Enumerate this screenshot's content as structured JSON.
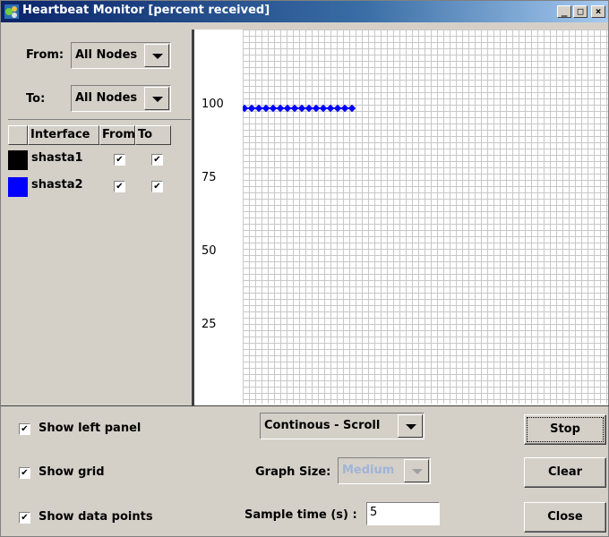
{
  "window": {
    "title": "Heartbeat Monitor [percent received]",
    "controls": {
      "minimize": "_",
      "maximize": "□",
      "close": "×"
    }
  },
  "left_panel": {
    "from_label": "From:",
    "from_value": "All Nodes",
    "to_label": "To:",
    "to_value": "All Nodes",
    "table": {
      "headers": [
        "Interface",
        "From",
        "To"
      ],
      "rows": [
        {
          "color": "#000000",
          "name": "shasta1",
          "from": true,
          "to": true
        },
        {
          "color": "#0000ff",
          "name": "shasta2",
          "from": true,
          "to": true
        }
      ]
    }
  },
  "graph": {
    "y_ticks": [
      "100",
      "75",
      "50",
      "25"
    ],
    "series_color": "#0000ff",
    "points": 16,
    "value": 100
  },
  "options": {
    "show_left_panel": "Show left panel",
    "show_grid": "Show grid",
    "show_data_points": "Show data points",
    "mode_value": "Continous - Scroll",
    "graph_size_label": "Graph Size:",
    "graph_size_value": "Medium",
    "sample_time_label": "Sample time (s) :",
    "sample_time_value": "5"
  },
  "buttons": {
    "stop": "Stop",
    "clear": "Clear",
    "close": "Close"
  },
  "check_mark": "✔"
}
